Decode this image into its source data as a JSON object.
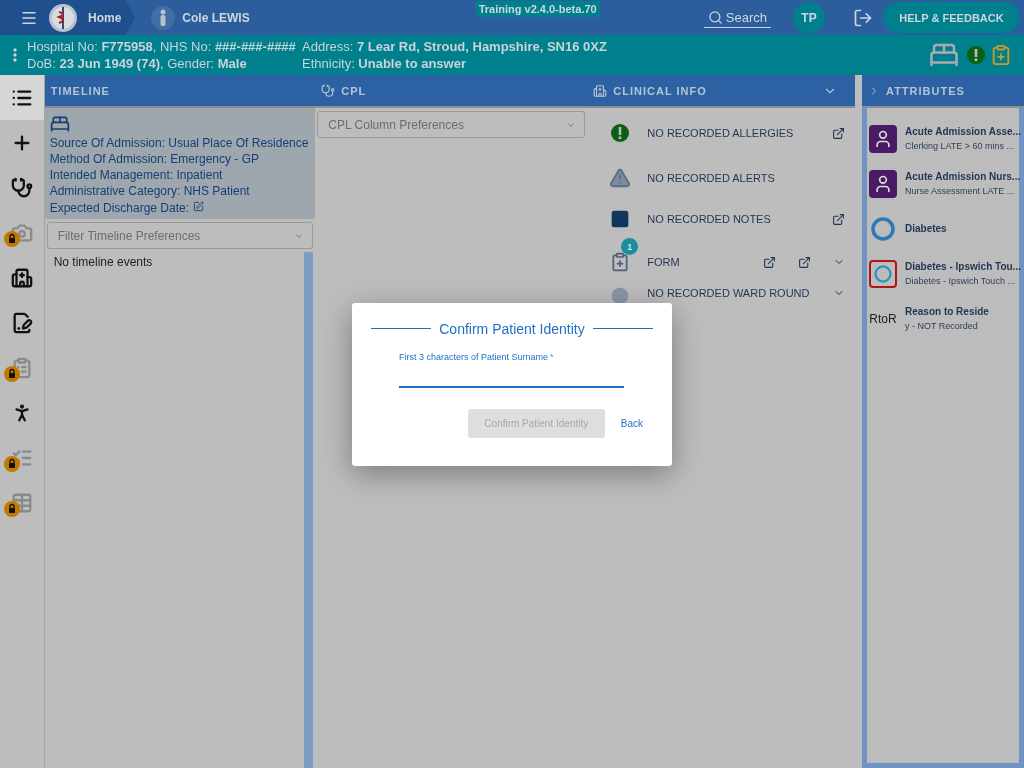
{
  "topbar": {
    "home": "Home",
    "patient": "Cole LEWIS",
    "version": "Training v2.4.0-beta.70",
    "search": "Search",
    "avatar": "TP",
    "help": "HELP & FEEDBACK"
  },
  "banner": {
    "lines": [
      [
        "Hospital No: **F775958**, NHS No: **###-###-####**",
        "Address: **7 Lear Rd, Stroud, Hampshire, SN16 0XZ**"
      ],
      [
        "DoB: **23 Jun 1949 (74)**, Gender: **Male**",
        "Ethnicity: **Unable to answer**"
      ]
    ]
  },
  "sidebar": {
    "items": [
      {
        "kind": "list",
        "selected": true,
        "locked": false
      },
      {
        "kind": "plus",
        "selected": false,
        "locked": false
      },
      {
        "kind": "stethoscope",
        "selected": false,
        "locked": false
      },
      {
        "kind": "camera",
        "selected": false,
        "locked": true
      },
      {
        "kind": "house",
        "selected": false,
        "locked": false
      },
      {
        "kind": "sign",
        "selected": false,
        "locked": false
      },
      {
        "kind": "clipboard",
        "selected": false,
        "locked": true
      },
      {
        "kind": "walk",
        "selected": false,
        "locked": false
      },
      {
        "kind": "checklist",
        "selected": false,
        "locked": true
      },
      {
        "kind": "table",
        "selected": false,
        "locked": true
      }
    ]
  },
  "timeline": {
    "title": "TIMELINE",
    "details": [
      "Source Of Admission: Usual Place Of Residence",
      "Method Of Admission: Emergency - GP",
      "Intended Management: Inpatient",
      "Administrative Category: NHS Patient",
      "Expected Discharge Date:"
    ],
    "filter_placeholder": "Filter Timeline Preferences",
    "empty": "No timeline events"
  },
  "cpl": {
    "title": "CPL",
    "select_placeholder": "CPL Column Preferences"
  },
  "clinical_info": {
    "title": "CLINICAL INFO",
    "rows": [
      {
        "kind": "allergy",
        "text": "NO RECORDED ALLERGIES"
      },
      {
        "kind": "alert",
        "text": "NO RECORDED ALERTS"
      },
      {
        "kind": "notes",
        "text": "NO RECORDED NOTES"
      },
      {
        "kind": "form",
        "text": "FORM",
        "badge": "1"
      },
      {
        "kind": "ward",
        "text": "NO RECORDED WARD ROUND"
      }
    ]
  },
  "attributes": {
    "title": "ATTRIBUTES",
    "items": [
      {
        "kind": "clerk",
        "title": "Acute Admission Asse...",
        "subtitle": "Clerking LATE > 60 mins ..."
      },
      {
        "kind": "nurse",
        "title": "Acute Admission Nurs...",
        "subtitle": "Nurse Assessment LATE ..."
      },
      {
        "kind": "ring",
        "title": "Diabetes"
      },
      {
        "kind": "ring-boxed",
        "title": "Diabetes - Ipswich Tou...",
        "subtitle": "Diabetes - Ipswich Touch ..."
      },
      {
        "kind": "text",
        "tag": "RtoR",
        "title": "Reason to Reside",
        "subtitle": "y - NOT Recorded"
      }
    ]
  },
  "dialog": {
    "title": "Confirm Patient Identity",
    "field_label": "First 3 characters of Patient Surname",
    "required": "*",
    "confirm": {
      "label": "Confirm Patient Identity",
      "disabled": true
    },
    "back": "Back"
  }
}
